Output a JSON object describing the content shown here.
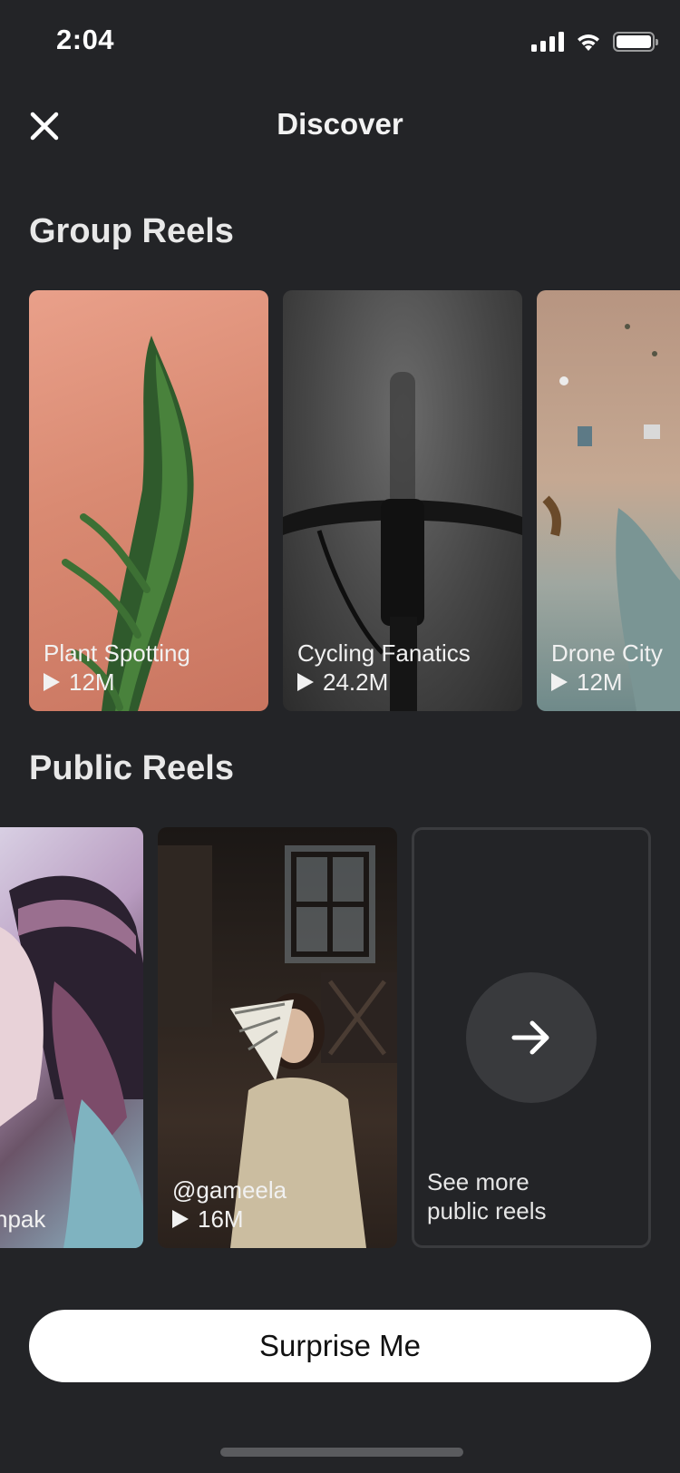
{
  "status_bar": {
    "time": "2:04"
  },
  "header": {
    "title": "Discover"
  },
  "group_reels": {
    "title": "Group Reels",
    "cards": [
      {
        "name": "Plant Spotting",
        "views": "12M"
      },
      {
        "name": "Cycling Fanatics",
        "views": "24.2M"
      },
      {
        "name": "Drone City",
        "views": "12M"
      }
    ]
  },
  "public_reels": {
    "title": "Public Reels",
    "cards": [
      {
        "name": "npak",
        "views": ""
      },
      {
        "name": "@gameela",
        "views": "16M"
      }
    ],
    "see_more_line1": "See more",
    "see_more_line2": "public reels"
  },
  "surprise_button": {
    "label": "Surprise Me"
  },
  "colors": {
    "background": "#232427",
    "button": "#ffffff",
    "card_border": "#3a3b3e"
  },
  "icons": [
    "close-icon",
    "signal-icon",
    "wifi-icon",
    "battery-icon",
    "play-icon",
    "arrow-right-icon"
  ]
}
